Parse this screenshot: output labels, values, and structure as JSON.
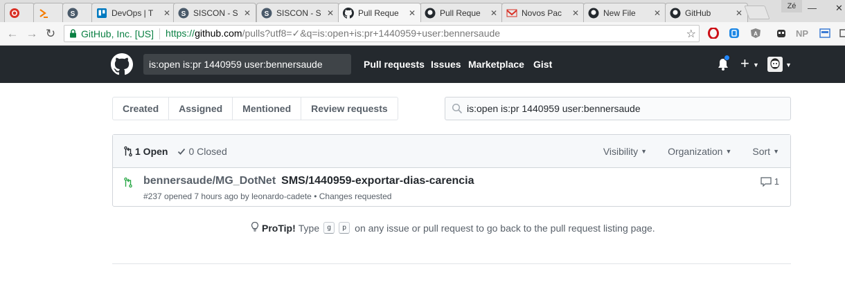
{
  "browser": {
    "tabs": [
      {
        "title": "",
        "icon": "recycle-icon",
        "color": "#d93025"
      },
      {
        "title": "",
        "icon": "prompt-icon",
        "color": "#f57c00"
      },
      {
        "title": "",
        "icon": "s-circle-icon",
        "color": "#4a5a6a"
      },
      {
        "title": "DevOps | T",
        "icon": "trello-icon",
        "color": "#0079bf"
      },
      {
        "title": "SISCON - S",
        "icon": "s-circle-icon",
        "color": "#4a5a6a"
      },
      {
        "title": "SISCON - S",
        "icon": "s-circle-icon",
        "color": "#4a5a6a"
      },
      {
        "title": "Pull Reque",
        "icon": "github-icon",
        "color": "#24292e"
      },
      {
        "title": "Pull Reque",
        "icon": "github-icon",
        "color": "#24292e"
      },
      {
        "title": "Novos Pac",
        "icon": "mail-icon",
        "color": "#d93025"
      },
      {
        "title": "New File",
        "icon": "github-icon",
        "color": "#24292e"
      },
      {
        "title": "GitHub",
        "icon": "github-icon",
        "color": "#24292e"
      }
    ],
    "profile_label": "Zé",
    "omnibox": {
      "secure_label": "GitHub, Inc. [US]",
      "url_scheme": "https://",
      "url_host": "github.com",
      "url_path": "/pulls?utf8=✓&q=is:open+is:pr+1440959+user:bennersaude"
    },
    "extensions": [
      {
        "icon": "opera-icon",
        "label": "",
        "color": "#cc0f16"
      },
      {
        "icon": "box-icon",
        "label": "",
        "color": "#1e88e5"
      },
      {
        "icon": "angular-icon",
        "label": "",
        "color": "#777"
      },
      {
        "icon": "ghostery-icon",
        "label": "",
        "color": "#333"
      },
      {
        "icon": "np-icon",
        "label": "NP",
        "color": "#999"
      },
      {
        "icon": "image-icon",
        "label": "",
        "color": "#3b7bd4"
      },
      {
        "icon": "cast-icon",
        "label": "",
        "color": "#555"
      }
    ]
  },
  "header": {
    "search_value": "is:open is:pr 1440959 user:bennersaude",
    "nav": [
      "Pull requests",
      "Issues",
      "Marketplace",
      "Gist"
    ],
    "accent": "#2188ff"
  },
  "subnav": {
    "items": [
      "Created",
      "Assigned",
      "Mentioned",
      "Review requests"
    ]
  },
  "filter": {
    "value": "is:open is:pr 1440959 user:bennersaude"
  },
  "box": {
    "open_label": "1 Open",
    "closed_label": "0 Closed",
    "filters": [
      "Visibility",
      "Organization",
      "Sort"
    ],
    "rows": [
      {
        "repo": "bennersaude/MG_DotNet",
        "title": "SMS/1440959-exportar-dias-carencia",
        "meta": "#237 opened 7 hours ago by leonardo-cadete • Changes requested",
        "comments": "1"
      }
    ]
  },
  "protip": {
    "label": "ProTip!",
    "before": "Type",
    "key1": "g",
    "key2": "p",
    "after": "on any issue or pull request to go back to the pull request listing page."
  }
}
